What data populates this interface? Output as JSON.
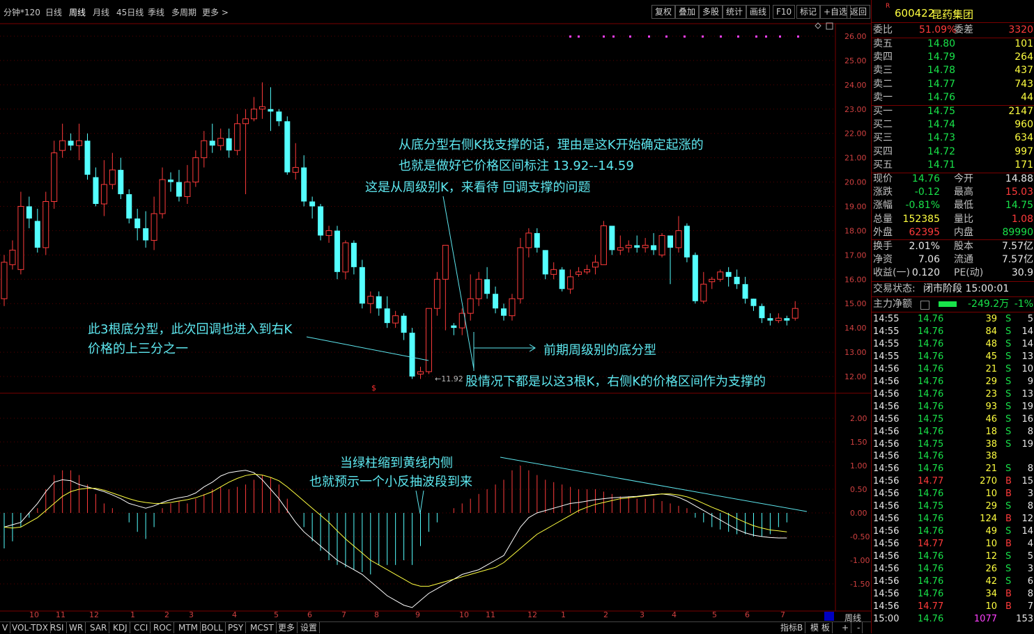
{
  "toolbar": {
    "periods": [
      "分钟*120",
      "日线",
      "周线",
      "月线",
      "45日线",
      "季线",
      "多周期",
      "更多 >"
    ],
    "active_period": "周线",
    "tools": [
      "复权",
      "叠加",
      "多股",
      "统计",
      "画线",
      "F10",
      "标记",
      "+自选",
      "返回"
    ]
  },
  "chart_data": [
    {
      "type": "candlestick",
      "title": "",
      "y_ticks": [
        "26.00",
        "25.00",
        "24.00",
        "23.00",
        "22.00",
        "21.00",
        "20.00",
        "19.00",
        "18.00",
        "17.00",
        "16.00",
        "15.00",
        "14.00",
        "13.00",
        "12.00"
      ],
      "ylim": [
        11.6,
        26.3
      ],
      "min_label": "←11.92",
      "ohlc": [
        [
          15.2,
          16.7,
          14.9,
          17.0
        ],
        [
          16.6,
          17.2,
          16.4,
          17.6
        ],
        [
          16.4,
          19.0,
          16.2,
          19.6
        ],
        [
          19.0,
          18.5,
          18.1,
          19.4
        ],
        [
          18.4,
          17.3,
          17.1,
          18.9
        ],
        [
          17.3,
          19.2,
          17.0,
          19.6
        ],
        [
          19.2,
          21.2,
          18.9,
          21.7
        ],
        [
          21.3,
          21.7,
          21.0,
          22.4
        ],
        [
          21.7,
          21.5,
          21.3,
          22.0
        ],
        [
          21.5,
          21.7,
          20.9,
          22.4
        ],
        [
          21.7,
          20.3,
          20.1,
          22.0
        ],
        [
          20.2,
          19.1,
          19.0,
          20.6
        ],
        [
          19.1,
          19.9,
          18.6,
          20.9
        ],
        [
          19.9,
          20.5,
          19.7,
          21.2
        ],
        [
          20.5,
          19.5,
          19.3,
          21.0
        ],
        [
          19.5,
          18.5,
          18.3,
          19.7
        ],
        [
          18.5,
          18.1,
          17.6,
          18.9
        ],
        [
          18.1,
          17.6,
          17.3,
          18.8
        ],
        [
          17.6,
          18.7,
          17.2,
          19.4
        ],
        [
          18.7,
          20.1,
          18.5,
          20.6
        ],
        [
          20.1,
          20.0,
          19.6,
          20.4
        ],
        [
          20.0,
          19.4,
          19.2,
          20.5
        ],
        [
          19.4,
          20.0,
          19.1,
          20.7
        ],
        [
          20.0,
          21.0,
          19.8,
          21.3
        ],
        [
          21.0,
          21.7,
          20.6,
          22.1
        ],
        [
          21.7,
          21.5,
          21.2,
          22.4
        ],
        [
          21.5,
          21.8,
          21.3,
          22.2
        ],
        [
          21.8,
          21.3,
          21.0,
          22.2
        ],
        [
          21.3,
          22.4,
          21.1,
          22.8
        ],
        [
          22.4,
          22.6,
          19.5,
          23.0
        ],
        [
          22.6,
          23.0,
          22.5,
          23.5
        ],
        [
          23.0,
          23.1,
          22.6,
          24.1
        ],
        [
          23.0,
          22.9,
          22.1,
          23.9
        ],
        [
          22.9,
          22.5,
          22.3,
          23.0
        ],
        [
          22.5,
          20.4,
          20.3,
          22.7
        ],
        [
          20.4,
          20.6,
          20.1,
          21.6
        ],
        [
          20.6,
          19.2,
          19.0,
          21.1
        ],
        [
          19.2,
          19.0,
          18.5,
          19.4
        ],
        [
          19.0,
          17.8,
          17.6,
          19.1
        ],
        [
          17.8,
          18.0,
          17.5,
          18.2
        ],
        [
          18.0,
          16.3,
          16.0,
          18.2
        ],
        [
          16.3,
          17.5,
          16.0,
          17.6
        ],
        [
          17.5,
          16.5,
          16.2,
          17.6
        ],
        [
          16.5,
          15.0,
          14.8,
          16.8
        ],
        [
          15.0,
          15.3,
          14.6,
          15.5
        ],
        [
          15.3,
          14.8,
          14.5,
          15.5
        ],
        [
          14.8,
          14.2,
          14.0,
          15.3
        ],
        [
          14.2,
          14.5,
          14.0,
          14.7
        ],
        [
          14.5,
          13.8,
          13.5,
          14.6
        ],
        [
          13.8,
          12.0,
          11.9,
          14.0
        ],
        [
          12.1,
          12.2,
          11.9,
          12.4
        ],
        [
          12.2,
          14.8,
          12.1,
          14.8
        ],
        [
          14.8,
          16.0,
          14.5,
          16.3
        ],
        [
          16.0,
          17.4,
          13.9,
          17.4
        ],
        [
          14.1,
          14.0,
          13.7,
          14.2
        ],
        [
          14.0,
          14.6,
          13.7,
          14.8
        ],
        [
          14.6,
          15.2,
          14.3,
          16.2
        ],
        [
          15.2,
          16.0,
          14.9,
          16.3
        ],
        [
          16.0,
          15.4,
          15.2,
          16.5
        ],
        [
          15.4,
          14.8,
          14.6,
          15.7
        ],
        [
          14.8,
          14.5,
          14.3,
          15.0
        ],
        [
          14.5,
          15.2,
          14.3,
          15.4
        ],
        [
          15.2,
          17.3,
          15.0,
          17.7
        ],
        [
          17.3,
          17.9,
          16.9,
          18.1
        ],
        [
          17.9,
          17.3,
          17.1,
          18.1
        ],
        [
          17.2,
          16.2,
          16.0,
          17.2
        ],
        [
          16.2,
          16.4,
          16.0,
          16.7
        ],
        [
          16.4,
          15.6,
          15.5,
          16.5
        ],
        [
          15.6,
          16.1,
          15.4,
          16.4
        ],
        [
          16.2,
          16.3,
          16.1,
          16.5
        ],
        [
          16.3,
          16.4,
          16.2,
          16.6
        ],
        [
          16.5,
          16.7,
          16.2,
          17.0
        ],
        [
          16.6,
          18.2,
          16.6,
          18.4
        ],
        [
          18.2,
          17.2,
          17.0,
          18.2
        ],
        [
          17.2,
          17.3,
          17.0,
          17.8
        ],
        [
          17.3,
          17.4,
          17.1,
          17.6
        ],
        [
          17.4,
          17.3,
          17.1,
          17.8
        ],
        [
          17.3,
          17.4,
          17.1,
          17.7
        ],
        [
          17.4,
          17.2,
          17.0,
          17.9
        ],
        [
          17.0,
          17.8,
          16.9,
          17.9
        ],
        [
          17.8,
          17.3,
          15.8,
          17.7
        ],
        [
          17.3,
          18.0,
          17.1,
          18.6
        ],
        [
          18.2,
          16.9,
          16.7,
          18.3
        ],
        [
          17.0,
          15.1,
          15.0,
          17.1
        ],
        [
          15.1,
          15.8,
          15.0,
          16.3
        ],
        [
          15.9,
          16.0,
          15.6,
          16.1
        ],
        [
          16.0,
          16.3,
          15.9,
          16.4
        ],
        [
          16.3,
          16.1,
          15.7,
          16.5
        ],
        [
          16.1,
          15.8,
          15.6,
          16.4
        ],
        [
          15.8,
          15.2,
          15.0,
          16.1
        ],
        [
          15.2,
          14.9,
          14.7,
          15.2
        ],
        [
          14.9,
          14.4,
          14.2,
          15.0
        ],
        [
          14.4,
          14.3,
          14.1,
          14.6
        ],
        [
          14.3,
          14.4,
          14.2,
          14.6
        ],
        [
          14.4,
          14.3,
          14.1,
          14.5
        ],
        [
          14.4,
          14.8,
          14.3,
          15.1
        ]
      ]
    },
    {
      "type": "macd",
      "y_ticks": [
        "2.00",
        "1.50",
        "1.00",
        "0.50",
        "0.00",
        "-0.50",
        "-1.00",
        "-1.50"
      ],
      "ylim": [
        -2.0,
        2.4
      ],
      "histogram": [
        -0.75,
        -0.6,
        -0.3,
        -0.1,
        0.1,
        0.5,
        0.8,
        0.9,
        0.9,
        0.8,
        0.6,
        0.4,
        0.2,
        0.1,
        0.0,
        -0.2,
        -0.4,
        -0.55,
        -0.3,
        0.1,
        0.2,
        0.25,
        0.2,
        0.3,
        0.4,
        0.5,
        0.55,
        0.5,
        0.55,
        0.6,
        0.7,
        0.8,
        0.75,
        0.6,
        0.3,
        0.0,
        -0.3,
        -0.6,
        -0.8,
        -1.0,
        -1.1,
        -1.15,
        -1.2,
        -1.25,
        -1.3,
        -1.1,
        -1.1,
        -1.1,
        -1.0,
        -1.1,
        -0.7,
        -0.4,
        -0.2,
        0.0,
        0.1,
        0.2,
        0.3,
        0.4,
        0.5,
        0.6,
        0.7,
        0.9,
        1.0,
        0.9,
        0.8,
        0.7,
        0.65,
        0.6,
        0.55,
        0.5,
        0.5,
        0.5,
        0.45,
        0.4,
        0.35,
        0.35,
        0.3,
        0.3,
        0.3,
        0.25,
        0.2,
        0.15,
        0.1,
        -0.1,
        -0.2,
        -0.3,
        -0.35,
        -0.4,
        -0.45,
        -0.45,
        -0.5,
        -0.5,
        -0.45,
        -0.3,
        -0.2
      ],
      "dif": [
        -0.3,
        -0.25,
        -0.2,
        0.0,
        0.2,
        0.45,
        0.65,
        0.7,
        0.68,
        0.6,
        0.55,
        0.5,
        0.45,
        0.38,
        0.3,
        0.2,
        0.15,
        0.1,
        0.15,
        0.22,
        0.28,
        0.32,
        0.35,
        0.42,
        0.55,
        0.65,
        0.78,
        0.85,
        0.88,
        0.9,
        0.85,
        0.7,
        0.5,
        0.3,
        0.05,
        -0.2,
        -0.4,
        -0.55,
        -0.7,
        -0.85,
        -1.0,
        -1.1,
        -1.2,
        -1.3,
        -1.45,
        -1.6,
        -1.75,
        -1.85,
        -1.95,
        -2.0,
        -1.85,
        -1.7,
        -1.6,
        -1.5,
        -1.4,
        -1.3,
        -1.25,
        -1.2,
        -1.1,
        -1.0,
        -0.9,
        -0.6,
        -0.3,
        -0.1,
        0.0,
        0.05,
        0.1,
        0.15,
        0.2,
        0.22,
        0.25,
        0.28,
        0.3,
        0.32,
        0.33,
        0.34,
        0.35,
        0.37,
        0.39,
        0.4,
        0.38,
        0.33,
        0.25,
        0.15,
        0.05,
        -0.05,
        -0.15,
        -0.25,
        -0.35,
        -0.42,
        -0.47,
        -0.5,
        -0.52,
        -0.53,
        -0.53
      ],
      "dea": [
        -0.3,
        -0.32,
        -0.3,
        -0.2,
        -0.1,
        0.05,
        0.2,
        0.35,
        0.45,
        0.5,
        0.52,
        0.52,
        0.48,
        0.42,
        0.36,
        0.3,
        0.25,
        0.22,
        0.2,
        0.2,
        0.22,
        0.25,
        0.28,
        0.32,
        0.38,
        0.45,
        0.55,
        0.65,
        0.73,
        0.79,
        0.82,
        0.8,
        0.75,
        0.68,
        0.55,
        0.4,
        0.25,
        0.1,
        -0.05,
        -0.2,
        -0.38,
        -0.55,
        -0.7,
        -0.85,
        -1.0,
        -1.1,
        -1.2,
        -1.3,
        -1.4,
        -1.5,
        -1.55,
        -1.55,
        -1.5,
        -1.45,
        -1.4,
        -1.35,
        -1.3,
        -1.25,
        -1.2,
        -1.15,
        -1.05,
        -0.9,
        -0.75,
        -0.6,
        -0.45,
        -0.35,
        -0.25,
        -0.15,
        -0.05,
        0.05,
        0.12,
        0.18,
        0.22,
        0.26,
        0.3,
        0.32,
        0.34,
        0.36,
        0.38,
        0.4,
        0.4,
        0.38,
        0.34,
        0.28,
        0.2,
        0.12,
        0.05,
        -0.03,
        -0.12,
        -0.2,
        -0.27,
        -0.32,
        -0.36,
        -0.38,
        -0.4
      ]
    }
  ],
  "x_axis": [
    "10",
    "11",
    "12",
    "1",
    "2",
    "3",
    "4",
    "5",
    "6",
    "7",
    "8",
    "9",
    "10",
    "11",
    "12",
    "1",
    "2",
    "3",
    "4",
    "5",
    "6",
    "7"
  ],
  "annotations": {
    "a1": "从底分型右侧K找支撑的话，理由是这K开始确定起涨的",
    "a2": "也就是做好它价格区间标注   13.92--14.59",
    "a3": "这是从周级别K，来看待    回调支撑的问题",
    "a4": "此3根底分型，此次回调也进入到右K",
    "a5": "价格的上三分之一",
    "a6": "前期周级别的底分型",
    "a7": "股情况下都是以这3根K，右侧K的价格区间作为支撑的",
    "a8": "当绿柱缩到黄线内侧",
    "a9": "也就预示一个小反抽波段到来"
  },
  "bottom_tabs": [
    "V",
    "VOL-TDX",
    "RSI",
    "WR",
    "SAR",
    "KDJ",
    "CCI",
    "ROC",
    "MTM",
    "BOLL",
    "PSY",
    "MCST",
    "更多",
    "设置"
  ],
  "bottom_right": [
    "指标B",
    "模 板",
    "+",
    "-",
    "周线"
  ],
  "quote": {
    "code_badge": "R",
    "code": "600422",
    "name": "昆药集团",
    "weibi_label": "委比",
    "weibi": "51.09%",
    "weicha_label": "委差",
    "weicha": "3320",
    "asks": [
      {
        "label": "卖五",
        "price": "14.80",
        "vol": "101"
      },
      {
        "label": "卖四",
        "price": "14.79",
        "vol": "264"
      },
      {
        "label": "卖三",
        "price": "14.78",
        "vol": "437"
      },
      {
        "label": "卖二",
        "price": "14.77",
        "vol": "743"
      },
      {
        "label": "卖一",
        "price": "14.76",
        "vol": "44"
      }
    ],
    "bids": [
      {
        "label": "买一",
        "price": "14.75",
        "vol": "2147"
      },
      {
        "label": "买二",
        "price": "14.74",
        "vol": "960"
      },
      {
        "label": "买三",
        "price": "14.73",
        "vol": "634"
      },
      {
        "label": "买四",
        "price": "14.72",
        "vol": "997"
      },
      {
        "label": "买五",
        "price": "14.71",
        "vol": "171"
      }
    ],
    "stats": [
      {
        "l1": "现价",
        "v1": "14.76",
        "c1": "g",
        "l2": "今开",
        "v2": "14.88",
        "c2": "w"
      },
      {
        "l1": "涨跌",
        "v1": "-0.12",
        "c1": "g",
        "l2": "最高",
        "v2": "15.03",
        "c2": "r"
      },
      {
        "l1": "涨幅",
        "v1": "-0.81%",
        "c1": "g",
        "l2": "最低",
        "v2": "14.75",
        "c2": "g"
      },
      {
        "l1": "总量",
        "v1": "152385",
        "c1": "y",
        "l2": "量比",
        "v2": "1.08",
        "c2": "r"
      },
      {
        "l1": "外盘",
        "v1": "62395",
        "c1": "r",
        "l2": "内盘",
        "v2": "89990",
        "c2": "g"
      }
    ],
    "stats2": [
      {
        "l1": "换手",
        "v1": "2.01%",
        "l2": "股本",
        "v2": "7.57亿"
      },
      {
        "l1": "净资",
        "v1": "7.06",
        "l2": "流通",
        "v2": "7.57亿"
      },
      {
        "l1": "收益(一)",
        "v1": "0.120",
        "l2": "PE(动)",
        "v2": "30.9"
      }
    ],
    "status_label": "交易状态:",
    "status": "闭市阶段 15:00:01",
    "flow_label": "主力净额",
    "flow_value": "-249.2万",
    "flow_pct": "-1%",
    "ticks": [
      [
        "14:55",
        "14.76",
        "39",
        "S",
        "5"
      ],
      [
        "14:55",
        "14.76",
        "84",
        "S",
        "14"
      ],
      [
        "14:55",
        "14.76",
        "48",
        "S",
        "14"
      ],
      [
        "14:55",
        "14.76",
        "45",
        "S",
        "13"
      ],
      [
        "14:56",
        "14.76",
        "21",
        "S",
        "10"
      ],
      [
        "14:56",
        "14.76",
        "29",
        "S",
        "9"
      ],
      [
        "14:56",
        "14.76",
        "23",
        "S",
        "13"
      ],
      [
        "14:56",
        "14.76",
        "93",
        "S",
        "19"
      ],
      [
        "14:56",
        "14.75",
        "46",
        "S",
        "16"
      ],
      [
        "14:56",
        "14.76",
        "18",
        "S",
        "8"
      ],
      [
        "14:56",
        "14.75",
        "38",
        "S",
        "19"
      ],
      [
        "14:56",
        "14.76",
        "38",
        "",
        ""
      ],
      [
        "14:56",
        "14.76",
        "21",
        "S",
        "8"
      ],
      [
        "14:56",
        "14.77",
        "270",
        "B",
        "15"
      ],
      [
        "14:56",
        "14.76",
        "10",
        "B",
        "3"
      ],
      [
        "14:56",
        "14.75",
        "29",
        "S",
        "8"
      ],
      [
        "14:56",
        "14.76",
        "124",
        "B",
        "12"
      ],
      [
        "14:56",
        "14.76",
        "49",
        "S",
        "14"
      ],
      [
        "14:56",
        "14.77",
        "10",
        "B",
        "4"
      ],
      [
        "14:56",
        "14.76",
        "12",
        "S",
        "5"
      ],
      [
        "14:56",
        "14.76",
        "26",
        "S",
        "3"
      ],
      [
        "14:56",
        "14.76",
        "42",
        "S",
        "6"
      ],
      [
        "14:56",
        "14.76",
        "34",
        "B",
        "8"
      ],
      [
        "14:56",
        "14.77",
        "10",
        "B",
        "7"
      ],
      [
        "15:00",
        "14.76",
        "1077",
        "",
        "153"
      ]
    ]
  }
}
